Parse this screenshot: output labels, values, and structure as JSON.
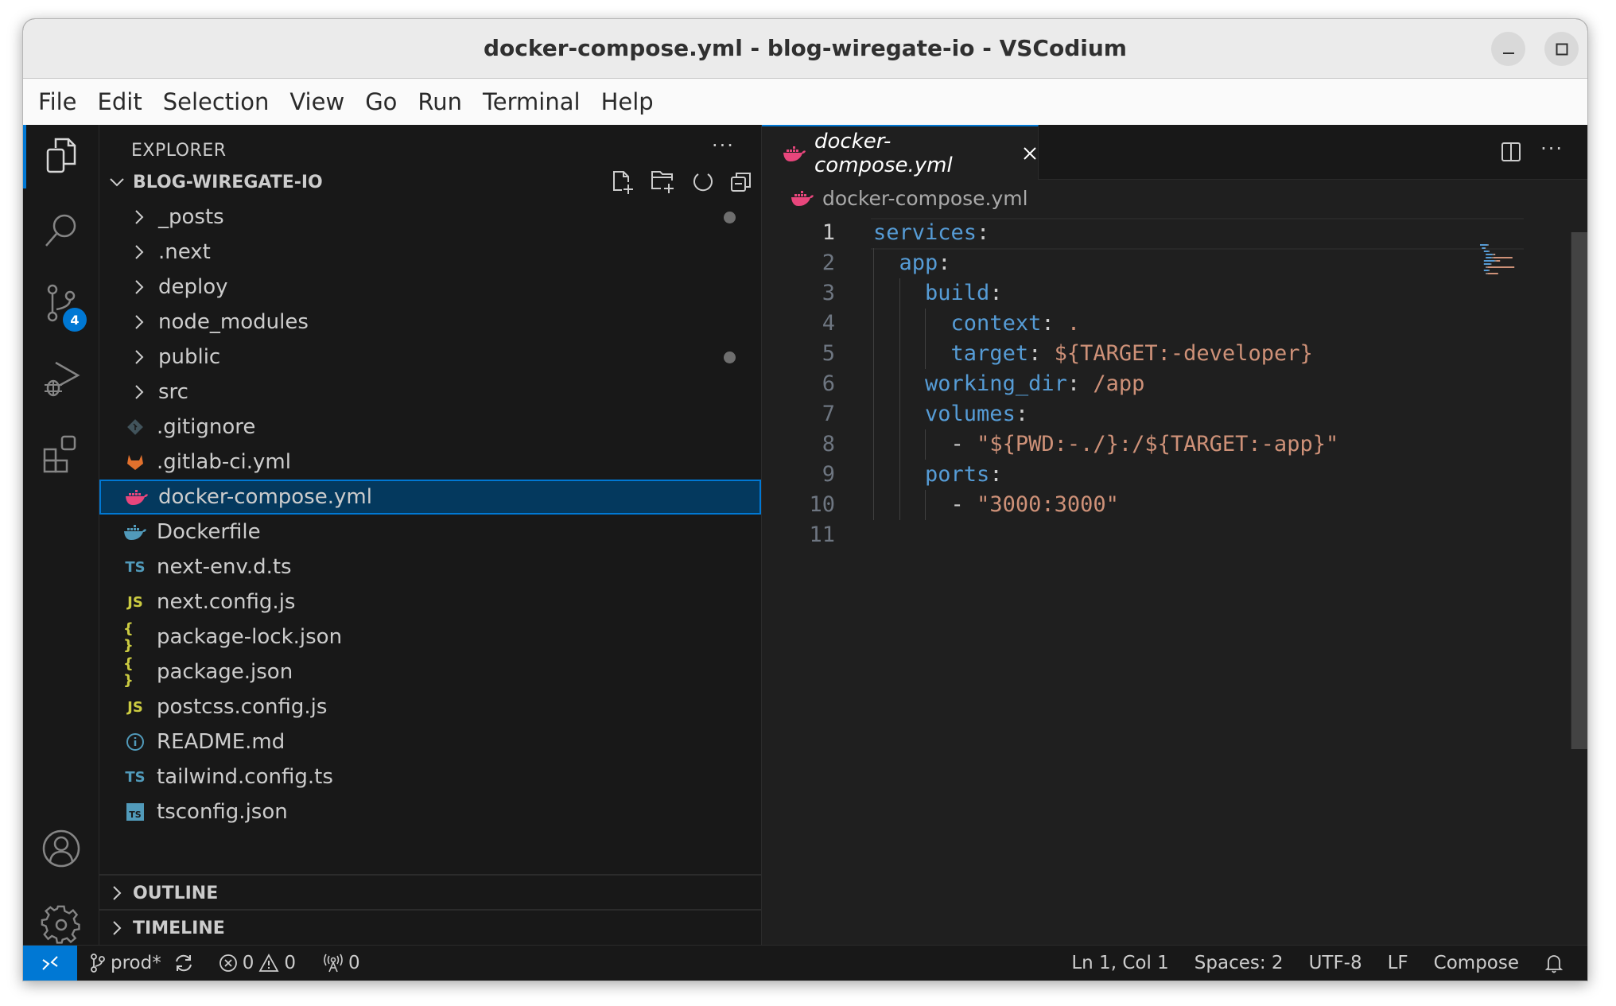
{
  "window": {
    "title": "docker-compose.yml - blog-wiregate-io - VSCodium"
  },
  "menu": [
    "File",
    "Edit",
    "Selection",
    "View",
    "Go",
    "Run",
    "Terminal",
    "Help"
  ],
  "activity_bar": {
    "items": [
      {
        "name": "explorer",
        "icon": "files-icon",
        "active": true
      },
      {
        "name": "search",
        "icon": "search-icon"
      },
      {
        "name": "source-control",
        "icon": "source-control-icon",
        "badge": "4"
      },
      {
        "name": "run-debug",
        "icon": "run-debug-icon"
      },
      {
        "name": "extensions",
        "icon": "extensions-icon"
      }
    ],
    "bottom": [
      {
        "name": "accounts",
        "icon": "account-icon"
      },
      {
        "name": "manage",
        "icon": "gear-icon"
      }
    ]
  },
  "sidebar": {
    "title": "EXPLORER",
    "more": "···",
    "root": "BLOG-WIREGATE-IO",
    "items": [
      {
        "label": "_posts",
        "type": "folder",
        "modified": true
      },
      {
        "label": ".next",
        "type": "folder"
      },
      {
        "label": "deploy",
        "type": "folder"
      },
      {
        "label": "node_modules",
        "type": "folder"
      },
      {
        "label": "public",
        "type": "folder",
        "modified": true
      },
      {
        "label": "src",
        "type": "folder"
      },
      {
        "label": ".gitignore",
        "type": "git",
        "icon": "◆",
        "color": "#41535b"
      },
      {
        "label": ".gitlab-ci.yml",
        "type": "gitlab",
        "icon": "gitlab",
        "color": "#e2712d"
      },
      {
        "label": "docker-compose.yml",
        "type": "docker",
        "icon": "docker",
        "color": "#e8467c",
        "selected": true
      },
      {
        "label": "Dockerfile",
        "type": "docker",
        "icon": "docker",
        "color": "#519aba"
      },
      {
        "label": "next-env.d.ts",
        "type": "ts",
        "icon": "TS",
        "color": "#519aba"
      },
      {
        "label": "next.config.js",
        "type": "js",
        "icon": "JS",
        "color": "#cbcb41"
      },
      {
        "label": "package-lock.json",
        "type": "json",
        "icon": "{ }",
        "color": "#cbcb41"
      },
      {
        "label": "package.json",
        "type": "json",
        "icon": "{ }",
        "color": "#cbcb41"
      },
      {
        "label": "postcss.config.js",
        "type": "js",
        "icon": "JS",
        "color": "#cbcb41"
      },
      {
        "label": "README.md",
        "type": "info",
        "icon": "i",
        "color": "#519aba"
      },
      {
        "label": "tailwind.config.ts",
        "type": "ts",
        "icon": "TS",
        "color": "#519aba"
      },
      {
        "label": "tsconfig.json",
        "type": "tsconfig",
        "icon": "TS",
        "color": "#519aba"
      }
    ],
    "sections": [
      "OUTLINE",
      "TIMELINE"
    ]
  },
  "editor": {
    "tab": {
      "label": "docker-compose.yml",
      "close": "×"
    },
    "breadcrumb": "docker-compose.yml",
    "lines": [
      {
        "n": "1",
        "tokens": [
          {
            "t": "services",
            "c": "k"
          },
          {
            "t": ":",
            "c": "p"
          }
        ]
      },
      {
        "n": "2",
        "tokens": [
          {
            "t": "  "
          },
          {
            "t": "app",
            "c": "k"
          },
          {
            "t": ":",
            "c": "p"
          }
        ]
      },
      {
        "n": "3",
        "tokens": [
          {
            "t": "    "
          },
          {
            "t": "build",
            "c": "k"
          },
          {
            "t": ":",
            "c": "p"
          }
        ]
      },
      {
        "n": "4",
        "tokens": [
          {
            "t": "      "
          },
          {
            "t": "context",
            "c": "k"
          },
          {
            "t": ": ",
            "c": "p"
          },
          {
            "t": ".",
            "c": "v"
          }
        ]
      },
      {
        "n": "5",
        "tokens": [
          {
            "t": "      "
          },
          {
            "t": "target",
            "c": "k"
          },
          {
            "t": ": ",
            "c": "p"
          },
          {
            "t": "${TARGET:-developer}",
            "c": "v"
          }
        ]
      },
      {
        "n": "6",
        "tokens": [
          {
            "t": "    "
          },
          {
            "t": "working_dir",
            "c": "k"
          },
          {
            "t": ": ",
            "c": "p"
          },
          {
            "t": "/app",
            "c": "v"
          }
        ]
      },
      {
        "n": "7",
        "tokens": [
          {
            "t": "    "
          },
          {
            "t": "volumes",
            "c": "k"
          },
          {
            "t": ":",
            "c": "p"
          }
        ]
      },
      {
        "n": "8",
        "tokens": [
          {
            "t": "      "
          },
          {
            "t": "- ",
            "c": "p"
          },
          {
            "t": "\"${PWD:-./}:/${TARGET:-app}\"",
            "c": "v"
          }
        ]
      },
      {
        "n": "9",
        "tokens": [
          {
            "t": "    "
          },
          {
            "t": "ports",
            "c": "k"
          },
          {
            "t": ":",
            "c": "p"
          }
        ]
      },
      {
        "n": "10",
        "tokens": [
          {
            "t": "      "
          },
          {
            "t": "- ",
            "c": "p"
          },
          {
            "t": "\"3000:3000\"",
            "c": "v"
          }
        ]
      },
      {
        "n": "11",
        "tokens": []
      }
    ],
    "current_line": "1"
  },
  "statusbar": {
    "branch": "prod*",
    "errors": "0",
    "warnings": "0",
    "ports": "0",
    "position": "Ln 1, Col 1",
    "indent": "Spaces: 2",
    "encoding": "UTF-8",
    "eol": "LF",
    "language": "Compose"
  },
  "colors": {
    "accent": "#0078d4",
    "selection": "#04395e",
    "key": "#569cd6",
    "value": "#ce9178"
  }
}
